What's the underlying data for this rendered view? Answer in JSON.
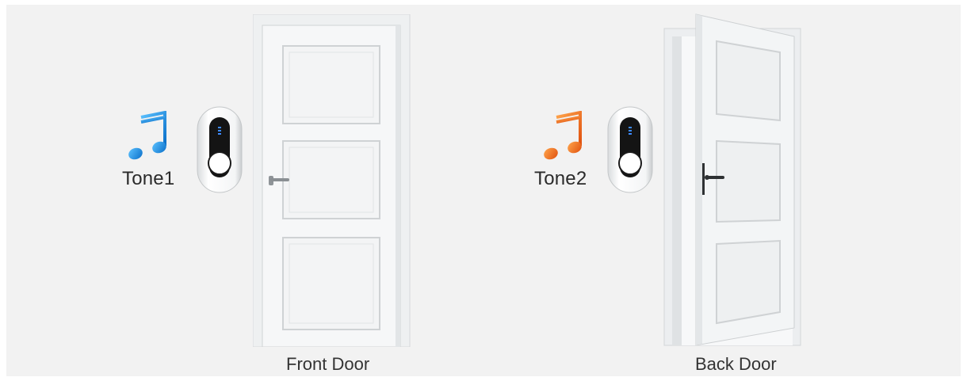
{
  "doorbells": [
    {
      "tone_label": "Tone1",
      "door_label": "Front Door",
      "note_icon": "music-note-icon",
      "note_color": "#1e8fe0",
      "door_state": "closed"
    },
    {
      "tone_label": "Tone2",
      "door_label": "Back Door",
      "note_icon": "music-note-icon",
      "note_color": "#ee6a1a",
      "door_state": "open"
    }
  ],
  "colors": {
    "background": "#f2f2f2",
    "door": "#f4f6f7",
    "button_body": "#ffffff",
    "button_face": "#141414",
    "indicator": "#3d8bff"
  }
}
